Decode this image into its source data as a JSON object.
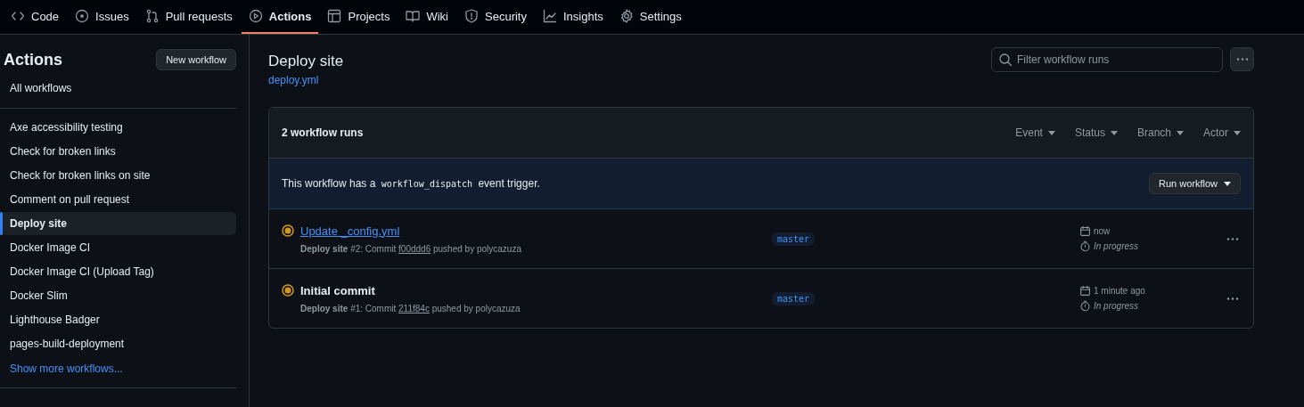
{
  "tabs": [
    {
      "label": "Code",
      "selected": false
    },
    {
      "label": "Issues",
      "selected": false
    },
    {
      "label": "Pull requests",
      "selected": false
    },
    {
      "label": "Actions",
      "selected": true
    },
    {
      "label": "Projects",
      "selected": false
    },
    {
      "label": "Wiki",
      "selected": false
    },
    {
      "label": "Security",
      "selected": false
    },
    {
      "label": "Insights",
      "selected": false
    },
    {
      "label": "Settings",
      "selected": false
    }
  ],
  "sidebar": {
    "title": "Actions",
    "new_button": "New workflow",
    "all_workflows": "All workflows",
    "items": [
      {
        "label": "Axe accessibility testing",
        "selected": false
      },
      {
        "label": "Check for broken links",
        "selected": false
      },
      {
        "label": "Check for broken links on site",
        "selected": false
      },
      {
        "label": "Comment on pull request",
        "selected": false
      },
      {
        "label": "Deploy site",
        "selected": true
      },
      {
        "label": "Docker Image CI",
        "selected": false
      },
      {
        "label": "Docker Image CI (Upload Tag)",
        "selected": false
      },
      {
        "label": "Docker Slim",
        "selected": false
      },
      {
        "label": "Lighthouse Badger",
        "selected": false
      },
      {
        "label": "pages-build-deployment",
        "selected": false
      }
    ],
    "show_more": "Show more workflows..."
  },
  "header": {
    "title": "Deploy site",
    "file": "deploy.yml",
    "search": {
      "placeholder": "Filter workflow runs"
    }
  },
  "runs_box": {
    "count": "2 workflow runs",
    "filters": [
      "Event",
      "Status",
      "Branch",
      "Actor"
    ],
    "notice": {
      "before": "This workflow has a",
      "code": "workflow_dispatch",
      "after": "event trigger."
    },
    "run_button": "Run workflow",
    "runs": [
      {
        "title": "Update _config.yml",
        "hovered": true,
        "prefix": "**Deploy site** #2: Commit",
        "commit": "f00ddd6",
        "suffix": "pushed by polycazuza",
        "branch": "master",
        "time": "now",
        "status": "In progress"
      },
      {
        "title": "Initial commit",
        "hovered": false,
        "prefix": "**Deploy site** #1: Commit",
        "commit": "211f84c",
        "suffix": "pushed by polycazuza",
        "branch": "master",
        "time": "1 minute ago",
        "status": "In progress"
      }
    ]
  }
}
